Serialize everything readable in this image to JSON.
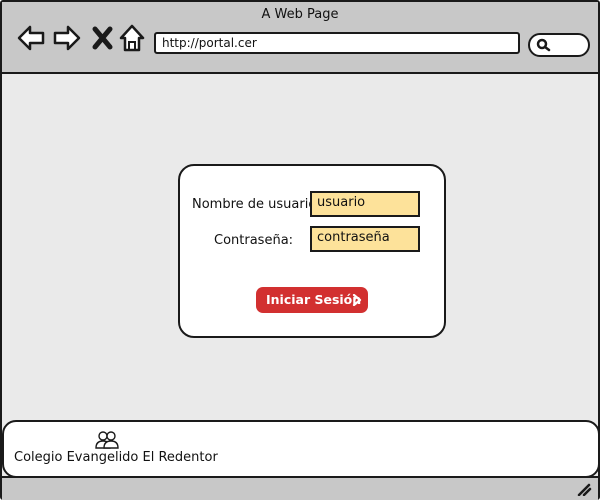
{
  "window": {
    "title": "A Web Page"
  },
  "browser": {
    "address": "http://portal.cer",
    "icons": [
      "back-arrow-icon",
      "forward-arrow-icon",
      "close-x-icon",
      "home-icon",
      "search-icon"
    ]
  },
  "login": {
    "username_label": "Nombre de usuario:",
    "username_value": "usuario",
    "password_label": "Contraseña:",
    "password_value": "contraseña",
    "submit_label": "Iniciar Sesión",
    "field_color": "#fde29a",
    "button_color": "#d23030"
  },
  "footer": {
    "icon": "users-icon",
    "text": "Colegio Evangelido El Redentor"
  }
}
